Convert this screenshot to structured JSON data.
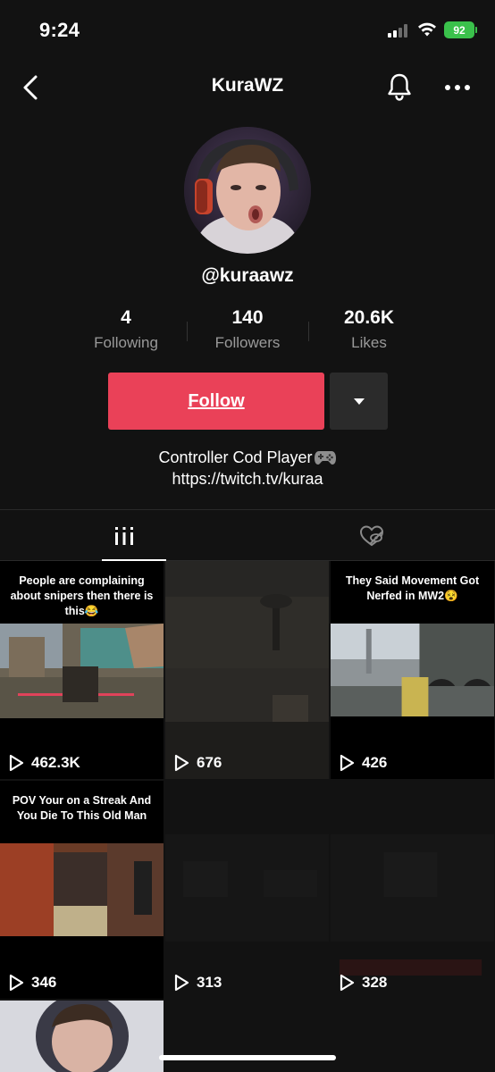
{
  "status_bar": {
    "time": "9:24",
    "battery": "92"
  },
  "nav": {
    "title": "KuraWZ"
  },
  "profile": {
    "username": "@kuraawz",
    "stats": [
      {
        "value": "4",
        "label": "Following"
      },
      {
        "value": "140",
        "label": "Followers"
      },
      {
        "value": "20.6K",
        "label": "Likes"
      }
    ],
    "follow_label": "Follow",
    "bio_line1": "Controller Cod Player",
    "bio_line2": "https://twitch.tv/kuraa"
  },
  "colors": {
    "follow": "#ea4158",
    "battery": "#3ac14b",
    "background": "#121212"
  },
  "videos": [
    {
      "caption": "People are complaining about snipers then there is this😂",
      "views": "462.3K"
    },
    {
      "caption": "",
      "views": "676"
    },
    {
      "caption": "They Said Movement Got Nerfed in MW2😵",
      "views": "426"
    },
    {
      "caption": "POV Your on a Streak And You Die To This Old Man",
      "views": "346"
    },
    {
      "caption": "",
      "views": "313"
    },
    {
      "caption": "",
      "views": "328"
    }
  ]
}
